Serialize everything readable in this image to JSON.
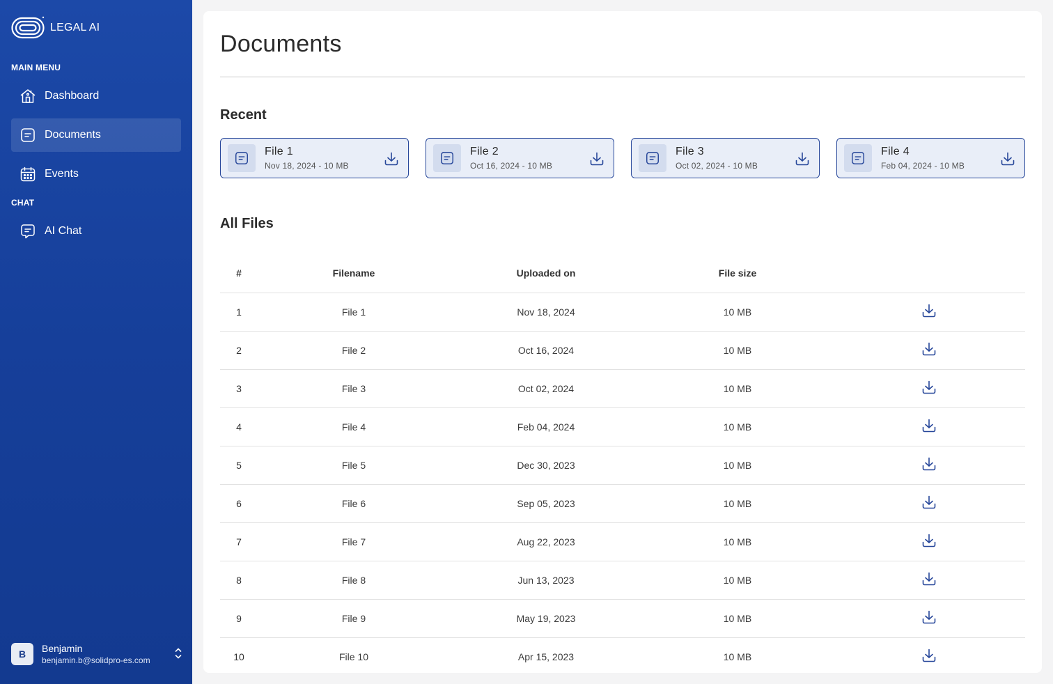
{
  "brand": {
    "name": "LEGAL AI",
    "logo_icon": "legal-ai-logo"
  },
  "sidebar": {
    "main_menu_label": "MAIN MENU",
    "chat_label": "CHAT",
    "items": [
      {
        "label": "Dashboard",
        "icon": "home-icon",
        "active": false
      },
      {
        "label": "Documents",
        "icon": "document-icon",
        "active": true
      },
      {
        "label": "Events",
        "icon": "calendar-icon",
        "active": false
      }
    ],
    "chat_items": [
      {
        "label": "AI Chat",
        "icon": "chat-bubble-icon",
        "active": false
      }
    ],
    "user": {
      "initial": "B",
      "name": "Benjamin",
      "email": "benjamin.b@solidpro-es.com"
    }
  },
  "main": {
    "title": "Documents",
    "recent_title": "Recent",
    "recent": [
      {
        "title": "File 1",
        "meta": "Nov 18, 2024 - 10 MB"
      },
      {
        "title": "File 2",
        "meta": "Oct 16, 2024 - 10 MB"
      },
      {
        "title": "File 3",
        "meta": "Oct 02, 2024 - 10 MB"
      },
      {
        "title": "File 4",
        "meta": "Feb 04, 2024 - 10 MB"
      }
    ],
    "all_files_title": "All Files",
    "table": {
      "headers": [
        "#",
        "Filename",
        "Uploaded on",
        "File size",
        ""
      ],
      "rows": [
        {
          "num": "1",
          "name": "File 1",
          "date": "Nov 18, 2024",
          "size": "10 MB"
        },
        {
          "num": "2",
          "name": "File 2",
          "date": "Oct 16, 2024",
          "size": "10 MB"
        },
        {
          "num": "3",
          "name": "File 3",
          "date": "Oct 02, 2024",
          "size": "10 MB"
        },
        {
          "num": "4",
          "name": "File 4",
          "date": "Feb 04, 2024",
          "size": "10 MB"
        },
        {
          "num": "5",
          "name": "File 5",
          "date": "Dec 30, 2023",
          "size": "10 MB"
        },
        {
          "num": "6",
          "name": "File 6",
          "date": "Sep 05, 2023",
          "size": "10 MB"
        },
        {
          "num": "7",
          "name": "File 7",
          "date": "Aug 22, 2023",
          "size": "10 MB"
        },
        {
          "num": "8",
          "name": "File 8",
          "date": "Jun 13, 2023",
          "size": "10 MB"
        },
        {
          "num": "9",
          "name": "File 9",
          "date": "May 19, 2023",
          "size": "10 MB"
        },
        {
          "num": "10",
          "name": "File 10",
          "date": "Apr 15, 2023",
          "size": "10 MB"
        }
      ]
    }
  },
  "colors": {
    "sidebar_bg": "#1c49a8",
    "accent": "#27479a",
    "card_bg": "#e9eef8",
    "page_bg": "#f4f4f5"
  }
}
